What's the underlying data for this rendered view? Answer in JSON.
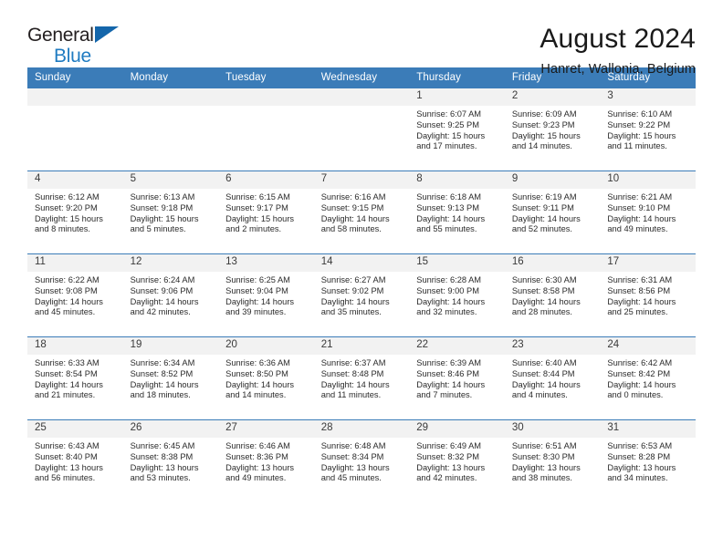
{
  "brand": {
    "name_part1": "General",
    "name_part2": "Blue",
    "logo_icon": "triangle-logo-icon"
  },
  "header": {
    "month_title": "August 2024",
    "location": "Hanret, Wallonia, Belgium"
  },
  "colors": {
    "header_blue": "#3b7cb8",
    "brand_blue": "#1f7bc1",
    "daynum_band": "#f2f2f2",
    "text": "#2b2b2b"
  },
  "calendar": {
    "weekday_headers": [
      "Sunday",
      "Monday",
      "Tuesday",
      "Wednesday",
      "Thursday",
      "Friday",
      "Saturday"
    ],
    "weeks": [
      [
        {
          "day": "",
          "lines": []
        },
        {
          "day": "",
          "lines": []
        },
        {
          "day": "",
          "lines": []
        },
        {
          "day": "",
          "lines": []
        },
        {
          "day": "1",
          "lines": [
            "Sunrise: 6:07 AM",
            "Sunset: 9:25 PM",
            "Daylight: 15 hours",
            "and 17 minutes."
          ]
        },
        {
          "day": "2",
          "lines": [
            "Sunrise: 6:09 AM",
            "Sunset: 9:23 PM",
            "Daylight: 15 hours",
            "and 14 minutes."
          ]
        },
        {
          "day": "3",
          "lines": [
            "Sunrise: 6:10 AM",
            "Sunset: 9:22 PM",
            "Daylight: 15 hours",
            "and 11 minutes."
          ]
        }
      ],
      [
        {
          "day": "4",
          "lines": [
            "Sunrise: 6:12 AM",
            "Sunset: 9:20 PM",
            "Daylight: 15 hours",
            "and 8 minutes."
          ]
        },
        {
          "day": "5",
          "lines": [
            "Sunrise: 6:13 AM",
            "Sunset: 9:18 PM",
            "Daylight: 15 hours",
            "and 5 minutes."
          ]
        },
        {
          "day": "6",
          "lines": [
            "Sunrise: 6:15 AM",
            "Sunset: 9:17 PM",
            "Daylight: 15 hours",
            "and 2 minutes."
          ]
        },
        {
          "day": "7",
          "lines": [
            "Sunrise: 6:16 AM",
            "Sunset: 9:15 PM",
            "Daylight: 14 hours",
            "and 58 minutes."
          ]
        },
        {
          "day": "8",
          "lines": [
            "Sunrise: 6:18 AM",
            "Sunset: 9:13 PM",
            "Daylight: 14 hours",
            "and 55 minutes."
          ]
        },
        {
          "day": "9",
          "lines": [
            "Sunrise: 6:19 AM",
            "Sunset: 9:11 PM",
            "Daylight: 14 hours",
            "and 52 minutes."
          ]
        },
        {
          "day": "10",
          "lines": [
            "Sunrise: 6:21 AM",
            "Sunset: 9:10 PM",
            "Daylight: 14 hours",
            "and 49 minutes."
          ]
        }
      ],
      [
        {
          "day": "11",
          "lines": [
            "Sunrise: 6:22 AM",
            "Sunset: 9:08 PM",
            "Daylight: 14 hours",
            "and 45 minutes."
          ]
        },
        {
          "day": "12",
          "lines": [
            "Sunrise: 6:24 AM",
            "Sunset: 9:06 PM",
            "Daylight: 14 hours",
            "and 42 minutes."
          ]
        },
        {
          "day": "13",
          "lines": [
            "Sunrise: 6:25 AM",
            "Sunset: 9:04 PM",
            "Daylight: 14 hours",
            "and 39 minutes."
          ]
        },
        {
          "day": "14",
          "lines": [
            "Sunrise: 6:27 AM",
            "Sunset: 9:02 PM",
            "Daylight: 14 hours",
            "and 35 minutes."
          ]
        },
        {
          "day": "15",
          "lines": [
            "Sunrise: 6:28 AM",
            "Sunset: 9:00 PM",
            "Daylight: 14 hours",
            "and 32 minutes."
          ]
        },
        {
          "day": "16",
          "lines": [
            "Sunrise: 6:30 AM",
            "Sunset: 8:58 PM",
            "Daylight: 14 hours",
            "and 28 minutes."
          ]
        },
        {
          "day": "17",
          "lines": [
            "Sunrise: 6:31 AM",
            "Sunset: 8:56 PM",
            "Daylight: 14 hours",
            "and 25 minutes."
          ]
        }
      ],
      [
        {
          "day": "18",
          "lines": [
            "Sunrise: 6:33 AM",
            "Sunset: 8:54 PM",
            "Daylight: 14 hours",
            "and 21 minutes."
          ]
        },
        {
          "day": "19",
          "lines": [
            "Sunrise: 6:34 AM",
            "Sunset: 8:52 PM",
            "Daylight: 14 hours",
            "and 18 minutes."
          ]
        },
        {
          "day": "20",
          "lines": [
            "Sunrise: 6:36 AM",
            "Sunset: 8:50 PM",
            "Daylight: 14 hours",
            "and 14 minutes."
          ]
        },
        {
          "day": "21",
          "lines": [
            "Sunrise: 6:37 AM",
            "Sunset: 8:48 PM",
            "Daylight: 14 hours",
            "and 11 minutes."
          ]
        },
        {
          "day": "22",
          "lines": [
            "Sunrise: 6:39 AM",
            "Sunset: 8:46 PM",
            "Daylight: 14 hours",
            "and 7 minutes."
          ]
        },
        {
          "day": "23",
          "lines": [
            "Sunrise: 6:40 AM",
            "Sunset: 8:44 PM",
            "Daylight: 14 hours",
            "and 4 minutes."
          ]
        },
        {
          "day": "24",
          "lines": [
            "Sunrise: 6:42 AM",
            "Sunset: 8:42 PM",
            "Daylight: 14 hours",
            "and 0 minutes."
          ]
        }
      ],
      [
        {
          "day": "25",
          "lines": [
            "Sunrise: 6:43 AM",
            "Sunset: 8:40 PM",
            "Daylight: 13 hours",
            "and 56 minutes."
          ]
        },
        {
          "day": "26",
          "lines": [
            "Sunrise: 6:45 AM",
            "Sunset: 8:38 PM",
            "Daylight: 13 hours",
            "and 53 minutes."
          ]
        },
        {
          "day": "27",
          "lines": [
            "Sunrise: 6:46 AM",
            "Sunset: 8:36 PM",
            "Daylight: 13 hours",
            "and 49 minutes."
          ]
        },
        {
          "day": "28",
          "lines": [
            "Sunrise: 6:48 AM",
            "Sunset: 8:34 PM",
            "Daylight: 13 hours",
            "and 45 minutes."
          ]
        },
        {
          "day": "29",
          "lines": [
            "Sunrise: 6:49 AM",
            "Sunset: 8:32 PM",
            "Daylight: 13 hours",
            "and 42 minutes."
          ]
        },
        {
          "day": "30",
          "lines": [
            "Sunrise: 6:51 AM",
            "Sunset: 8:30 PM",
            "Daylight: 13 hours",
            "and 38 minutes."
          ]
        },
        {
          "day": "31",
          "lines": [
            "Sunrise: 6:53 AM",
            "Sunset: 8:28 PM",
            "Daylight: 13 hours",
            "and 34 minutes."
          ]
        }
      ]
    ]
  }
}
